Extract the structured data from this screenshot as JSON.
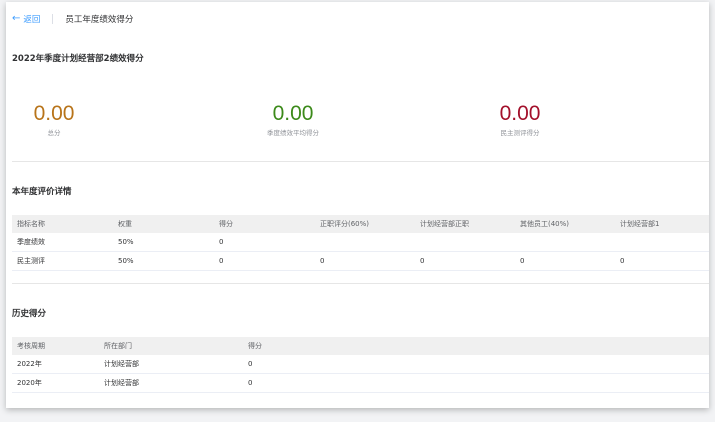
{
  "topbar": {
    "back_label": "返回",
    "back_icon": "←",
    "breadcrumb": "员工年度绩效得分"
  },
  "page_title": "2022年季度计划经营部2绩效得分",
  "scores": [
    {
      "value": "0.00",
      "label": "总分",
      "color": "#b8741a"
    },
    {
      "value": "0.00",
      "label": "季度绩效平均得分",
      "color": "#3c8a1a"
    },
    {
      "value": "0.00",
      "label": "民主测评得分",
      "color": "#a3102b"
    }
  ],
  "eval_section": {
    "title": "本年度评价详情",
    "headers": [
      "指标名称",
      "权重",
      "得分",
      "正职评分(60%)",
      "计划经营部正职",
      "其他员工(40%)",
      "计划经营部1"
    ],
    "rows": [
      [
        "季度绩效",
        "50%",
        "0",
        "",
        "",
        "",
        ""
      ],
      [
        "民主测评",
        "50%",
        "0",
        "0",
        "0",
        "0",
        "0"
      ]
    ]
  },
  "history_section": {
    "title": "历史得分",
    "headers": [
      "考核周期",
      "所在部门",
      "得分"
    ],
    "rows": [
      [
        "2022年",
        "计划经营部",
        "0"
      ],
      [
        "2020年",
        "计划经营部",
        "0"
      ]
    ]
  }
}
